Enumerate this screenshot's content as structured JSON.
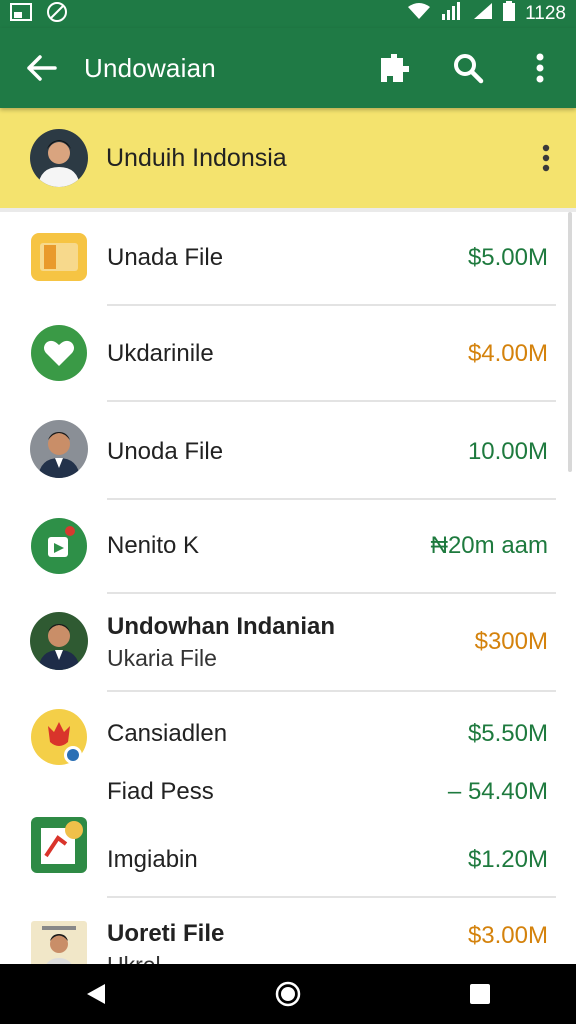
{
  "status_bar": {
    "time": "1128"
  },
  "app_bar": {
    "title": "Undowaian"
  },
  "account": {
    "name": "Unduih Indonsia"
  },
  "colors": {
    "primary": "#1f7a45",
    "header_yellow": "#f4e36e",
    "green_amount": "#1e7a3e",
    "orange_amount": "#d4820c"
  },
  "rows": [
    {
      "label": "Unada File",
      "amount": "$5.00M",
      "amount_color": "#1e7a3e",
      "icon": "folder-icon"
    },
    {
      "label": "Ukdarinile",
      "amount": "$4.00M",
      "amount_color": "#d4820c",
      "icon": "heart-icon"
    },
    {
      "label": "Unoda File",
      "amount": "10.00M",
      "amount_color": "#1e7a3e",
      "icon": "person-avatar"
    },
    {
      "label": "Nenito K",
      "amount": "₦20m aam",
      "amount_color": "#1e7a3e",
      "icon": "app-icon"
    },
    {
      "label": "Undowhan Indanian",
      "sublabel": "Ukaria File",
      "amount": "$300M",
      "amount_color": "#d4820c",
      "icon": "person-avatar"
    },
    {
      "label": "Cansiadlen",
      "amount": "$5.50M",
      "amount_color": "#1e7a3e",
      "icon": "flower-icon"
    },
    {
      "label": "Fiad Pess",
      "amount": "– 54.40M",
      "amount_color": "#1e7a3e",
      "icon": ""
    },
    {
      "label": "Imgiabin",
      "amount": "$1.20M",
      "amount_color": "#1e7a3e",
      "icon": "image-app-icon"
    },
    {
      "label": "Uoreti File",
      "sublabel": "Ukrel",
      "amount": "$3.00M",
      "amount_color": "#d4820c",
      "icon": "person-avatar"
    }
  ]
}
